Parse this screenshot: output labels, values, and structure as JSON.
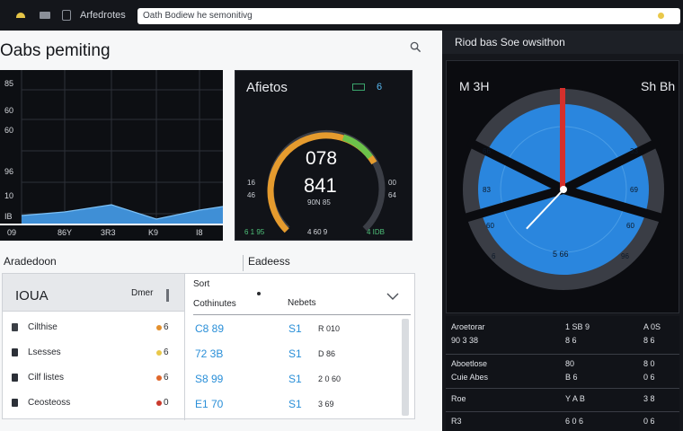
{
  "topbar": {
    "brand": "Arfedrotes",
    "url": "Oath Bodiew he semonitivg",
    "colors": {
      "bar": "#14161b",
      "accent": "#e9c84a"
    }
  },
  "main": {
    "title": "Oabs pemiting",
    "search_icon": "search-icon",
    "chart": {
      "y_labels": [
        "85",
        "60",
        "60",
        "96",
        "10",
        "IB"
      ],
      "x_labels": [
        "09",
        "86Y",
        "3R3",
        "K9",
        "I8"
      ],
      "fill_color": "#3f8fd6",
      "grid": true
    },
    "gauge": {
      "title": "Afietos",
      "top_value": "6",
      "value1": "078",
      "value2": "841",
      "sub": "90N 85",
      "left_small": [
        "46",
        "16"
      ],
      "right_small": [
        "00",
        "64"
      ],
      "bottom": [
        "6 1 95",
        "4 60 9",
        "4 IDB"
      ],
      "level": 0.72,
      "colors": {
        "ring": "#3b3e46",
        "warm": "#e59b2e",
        "green": "#6cc24a"
      }
    },
    "section_left": "Aradedoon",
    "section_mid": "Eadeess",
    "table": {
      "left_header": "IOUA",
      "left_button": "Dmer",
      "sort_label": "Sort",
      "col1": "Cothinutes",
      "col2": "Nebets",
      "left_rows": [
        {
          "icon": "bell-icon",
          "name": "Cilthise",
          "num": "6",
          "dot": "#e3902d"
        },
        {
          "icon": "square-icon",
          "name": "Lsesses",
          "num": "6",
          "dot": "#e9c84a"
        },
        {
          "icon": "square-icon",
          "name": "Cilf listes",
          "num": "6",
          "dot": "#e0662a"
        },
        {
          "icon": "square-icon",
          "name": "Ceosteoss",
          "num": "0",
          "dot": "#c93a2d"
        }
      ],
      "right_rows": [
        {
          "v1": "C8 89",
          "v2": "S1",
          "v3": "R 010"
        },
        {
          "v1": "72 3B",
          "v2": "S1",
          "v3": "D 86"
        },
        {
          "v1": "S8 99",
          "v2": "S1",
          "v3": "2 0 60"
        },
        {
          "v1": "E1 70",
          "v2": "S1",
          "v3": "3 69"
        }
      ]
    }
  },
  "right": {
    "title": "Riod bas Soe owsithon",
    "dial": {
      "left_label": "M 3H",
      "right_label": "Sh Bh",
      "left_ticks": [
        "66",
        "83",
        "60",
        "6"
      ],
      "right_ticks": [
        "33",
        "69",
        "60",
        "96"
      ],
      "bottom_text": "5 66",
      "hand_value": 0.62,
      "colors": {
        "face": "#2a86de",
        "ring": "#3a3d45",
        "needle": "#d6302c"
      }
    },
    "list": [
      {
        "a": "Aroetorar",
        "b": "1 SB 9",
        "c": "A 0S"
      },
      {
        "a": "90 3 38",
        "b": "8 6",
        "c": "8 6"
      },
      {
        "a": "Aboetlose",
        "b": "80",
        "c": "8 0"
      },
      {
        "a": "Cuie Abes",
        "b": "B 6",
        "c": "0 6"
      },
      {
        "a": "Roe",
        "b": "Y A B",
        "c": "3 8"
      },
      {
        "a": "R3",
        "b": "6 0 6",
        "c": "0 6"
      }
    ]
  }
}
